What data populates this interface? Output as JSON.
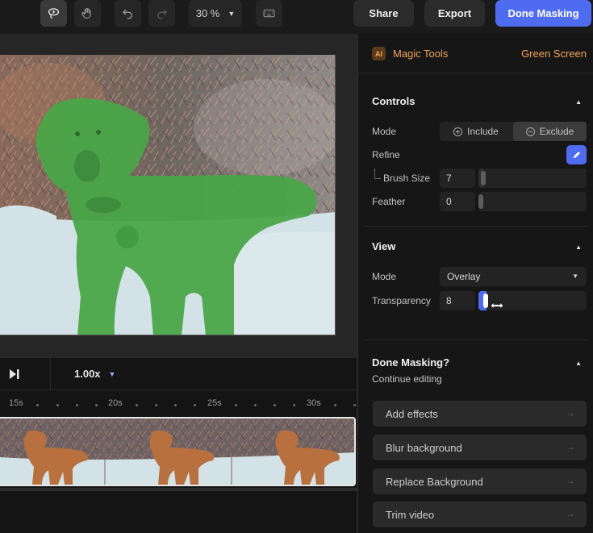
{
  "toolbar": {
    "zoom_value": "30 %",
    "buttons": {
      "share": "Share",
      "export": "Export",
      "done_masking": "Done Masking"
    }
  },
  "playback": {
    "speed": "1.00x"
  },
  "timeline": {
    "tick_labels": [
      "15s",
      "20s",
      "25s",
      "30s"
    ]
  },
  "panel": {
    "ai_badge": "AI",
    "title": "Magic Tools",
    "tool_name": "Green Screen",
    "controls": {
      "title": "Controls",
      "mode_label": "Mode",
      "mode_options": [
        "Include",
        "Exclude"
      ],
      "mode_selected": "Exclude",
      "refine_label": "Refine",
      "brush_size_label": "Brush Size",
      "brush_size_value": "7",
      "feather_label": "Feather",
      "feather_value": "0"
    },
    "view": {
      "title": "View",
      "mode_label": "Mode",
      "mode_value": "Overlay",
      "transparency_label": "Transparency",
      "transparency_value": "8"
    },
    "done": {
      "title": "Done Masking?",
      "subtitle": "Continue editing",
      "actions": [
        "Add effects",
        "Blur background",
        "Replace Background",
        "Trim video"
      ]
    }
  },
  "colors": {
    "accent": "#4f6bef",
    "mask_green": "#4aa548",
    "magic_orange": "#f0a45c"
  }
}
